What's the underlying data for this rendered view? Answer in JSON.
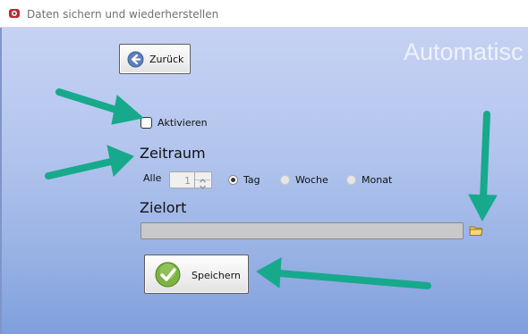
{
  "window": {
    "title": "Daten sichern und wiederherstellen",
    "icon": "app-icon"
  },
  "header": {
    "back_label": "Zurück",
    "heading": "Automatisc"
  },
  "activate": {
    "label": "Aktivieren",
    "checked": false
  },
  "zeitraum": {
    "label": "Zeitraum",
    "every_label": "Alle",
    "interval_value": "1",
    "options": [
      {
        "label": "Tag",
        "selected": true
      },
      {
        "label": "Woche",
        "selected": false
      },
      {
        "label": "Monat",
        "selected": false
      }
    ]
  },
  "zielort": {
    "label": "Zielort",
    "path_value": ""
  },
  "actions": {
    "save_label": "Speichern"
  },
  "colors": {
    "annotation_arrow": "#17a98b",
    "background_top": "#c6d2f3",
    "background_bottom": "#7f9fdc"
  }
}
